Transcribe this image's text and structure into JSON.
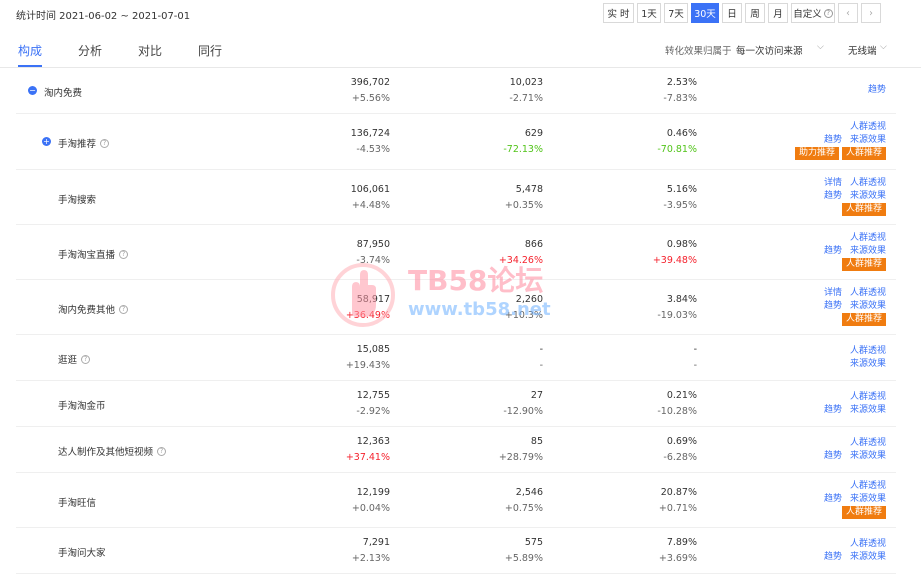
{
  "header": {
    "date_range": "统计时间 2021-06-02 ~ 2021-07-01",
    "periods": [
      "实 时",
      "1天",
      "7天",
      "30天",
      "日",
      "周",
      "月",
      "自定义"
    ],
    "active_period": "30天",
    "custom_suffix": "?"
  },
  "tabs": [
    "构成",
    "分析",
    "对比",
    "同行"
  ],
  "active_tab": "构成",
  "filters": {
    "attribution_label": "转化效果归属于",
    "attribution_value": "每一次访问来源",
    "device_value": "无线端"
  },
  "links": {
    "trend": "趋势",
    "crowd": "人群透视",
    "source": "来源效果",
    "detail": "详情",
    "boost": "助力推荐",
    "crowd_rec": "人群推荐"
  },
  "rows": [
    {
      "name": "淘内免费",
      "v1": "396,702",
      "d1": "+5.56%",
      "v2": "10,023",
      "d2": "-2.71%",
      "v3": "2.53%",
      "d3": "-7.83%"
    },
    {
      "name": "手淘推荐",
      "v1": "136,724",
      "d1": "-4.53%",
      "v2": "629",
      "d2": "-72.13%",
      "v3": "0.46%",
      "d3": "-70.81%"
    },
    {
      "name": "手淘搜索",
      "v1": "106,061",
      "d1": "+4.48%",
      "v2": "5,478",
      "d2": "+0.35%",
      "v3": "5.16%",
      "d3": "-3.95%"
    },
    {
      "name": "手淘淘宝直播",
      "v1": "87,950",
      "d1": "-3.74%",
      "v2": "866",
      "d2": "+34.26%",
      "v3": "0.98%",
      "d3": "+39.48%"
    },
    {
      "name": "淘内免费其他",
      "v1": "58,917",
      "d1": "+36.49%",
      "v2": "2,260",
      "d2": "+10.3%",
      "v3": "3.84%",
      "d3": "-19.03%"
    },
    {
      "name": "逛逛",
      "v1": "15,085",
      "d1": "+19.43%",
      "v2": "-",
      "d2": "-",
      "v3": "-",
      "d3": "-"
    },
    {
      "name": "手淘淘金币",
      "v1": "12,755",
      "d1": "-2.92%",
      "v2": "27",
      "d2": "-12.90%",
      "v3": "0.21%",
      "d3": "-10.28%"
    },
    {
      "name": "达人制作及其他短视频",
      "v1": "12,363",
      "d1": "+37.41%",
      "v2": "85",
      "d2": "+28.79%",
      "v3": "0.69%",
      "d3": "-6.28%"
    },
    {
      "name": "手淘旺信",
      "v1": "12,199",
      "d1": "+0.04%",
      "v2": "2,546",
      "d2": "+0.75%",
      "v3": "20.87%",
      "d3": "+0.71%"
    },
    {
      "name": "手淘问大家",
      "v1": "7,291",
      "d1": "+2.13%",
      "v2": "575",
      "d2": "+5.89%",
      "v3": "7.89%",
      "d3": "+3.69%"
    }
  ],
  "watermark": {
    "line1": "TB58论坛",
    "line2": "www.tb58.net"
  },
  "colors": {
    "accent": "#3b72f6",
    "up": "#f5222d",
    "down": "#52c41a",
    "badge": "#f07c10"
  }
}
